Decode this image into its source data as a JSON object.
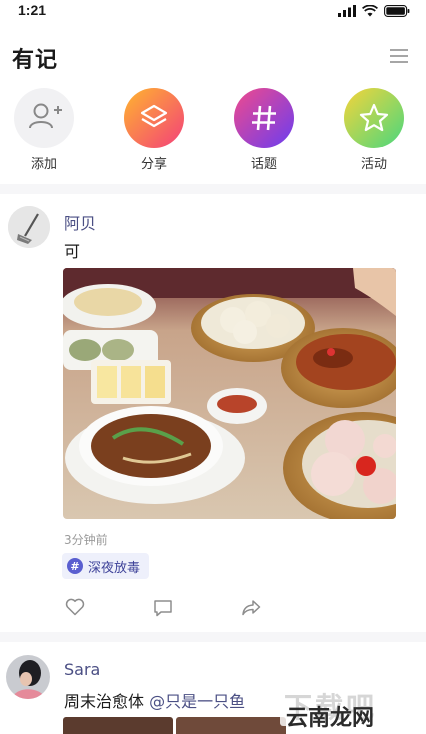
{
  "status_bar": {
    "time": "1:21"
  },
  "header": {
    "title": "有记"
  },
  "actions": [
    {
      "label": "添加",
      "icon": "add-user-icon"
    },
    {
      "label": "分享",
      "icon": "layers-icon"
    },
    {
      "label": "话题",
      "icon": "hash-icon"
    },
    {
      "label": "活动",
      "icon": "star-icon"
    }
  ],
  "colors": {
    "share_gradient": [
      "#ffb52e",
      "#f3407a"
    ],
    "topic_gradient": [
      "#f04a8c",
      "#6b3df0"
    ],
    "activity_gradient": [
      "#f6d43a",
      "#49d77e"
    ],
    "username": "#4b4f84"
  },
  "feed": {
    "post1": {
      "username": "阿贝",
      "text": "可",
      "time": "3分钟前",
      "tag": "深夜放毒"
    },
    "post2": {
      "username": "Sara",
      "text": "周末治愈体 ",
      "mention": "@只是一只鱼"
    }
  },
  "watermark": {
    "text": "云南龙网"
  }
}
